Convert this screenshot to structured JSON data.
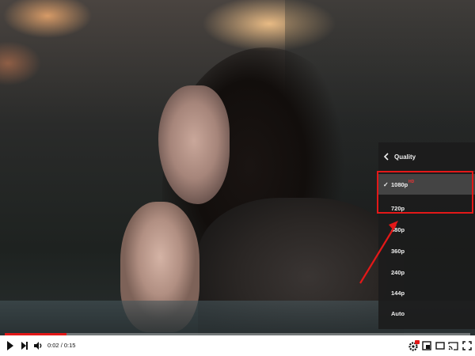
{
  "player": {
    "time_current": "0:02",
    "time_total": "0:15",
    "time_separator": " / ",
    "progress_fraction": 0.133,
    "accent_color": "#e31818"
  },
  "quality_menu": {
    "title": "Quality",
    "items": [
      {
        "label": "1080p",
        "selected": true,
        "hd": true
      },
      {
        "label": "720p",
        "selected": false,
        "hd": false
      },
      {
        "label": "480p",
        "selected": false,
        "hd": false
      },
      {
        "label": "360p",
        "selected": false,
        "hd": false
      },
      {
        "label": "240p",
        "selected": false,
        "hd": false
      },
      {
        "label": "144p",
        "selected": false,
        "hd": false
      },
      {
        "label": "Auto",
        "selected": false,
        "hd": false
      }
    ],
    "check_glyph": "✓",
    "hd_badge": "HD"
  },
  "icons": {
    "back": "chevron-left-icon",
    "play": "play-icon",
    "next": "next-icon",
    "volume": "volume-icon",
    "settings": "settings-gear-icon",
    "miniplayer": "miniplayer-icon",
    "theater": "theater-mode-icon",
    "cast": "cast-icon",
    "fullscreen": "fullscreen-icon"
  }
}
